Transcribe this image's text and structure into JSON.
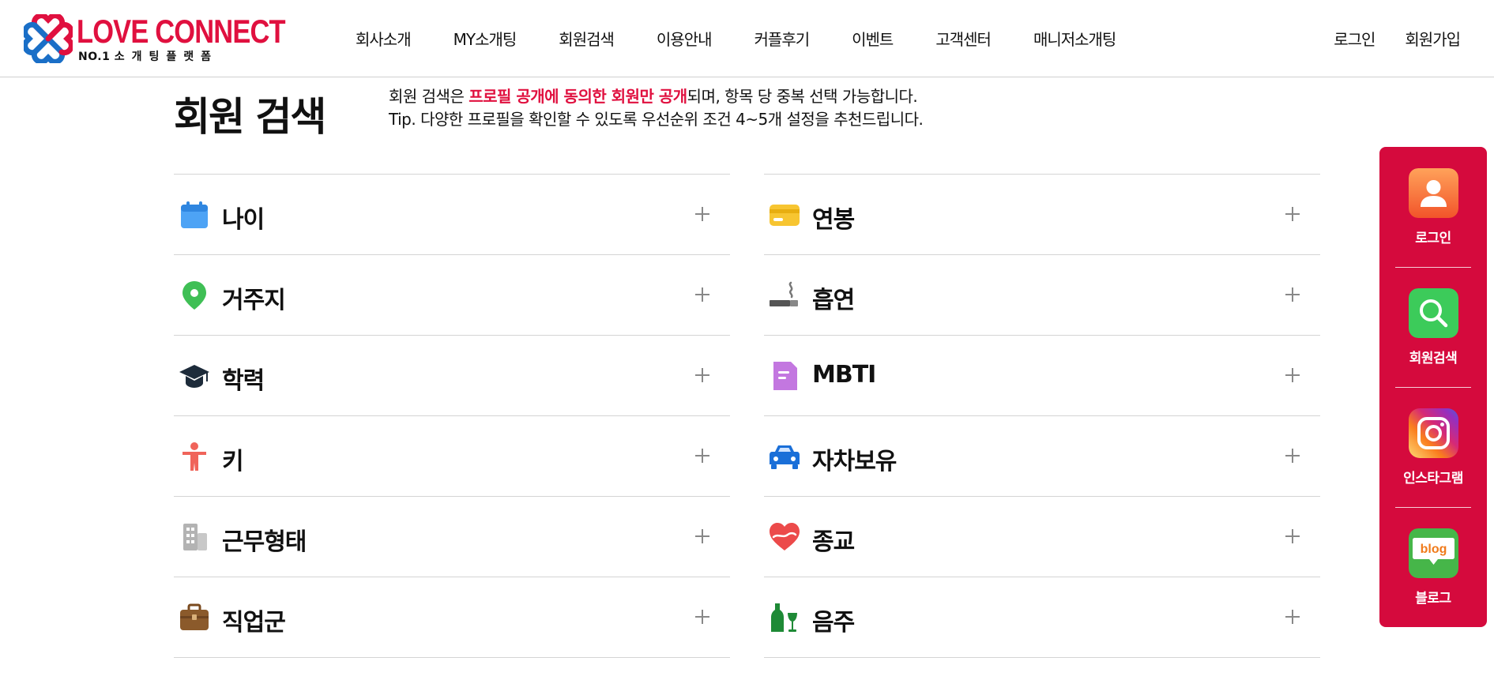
{
  "logo": {
    "name": "LOVE CONNECT",
    "tagline_prefix": "NO.1",
    "tagline": "소개팅플랫폼"
  },
  "nav": [
    "회사소개",
    "MY소개팅",
    "회원검색",
    "이용안내",
    "커플후기",
    "이벤트",
    "고객센터",
    "매니저소개팅"
  ],
  "auth": {
    "login": "로그인",
    "signup": "회원가입"
  },
  "page_title": "회원 검색",
  "description": {
    "line1_before": "회원 검색은 ",
    "line1_highlight": "프로필 공개에 동의한 회원만 공개",
    "line1_after": "되며, 항목 당 중복 선택 가능합니다.",
    "line2": "Tip. 다양한 프로필을 확인할 수 있도록 우선순위 조건 4~5개 설정을 추천드립니다."
  },
  "filters": {
    "left": [
      {
        "label": "나이",
        "icon": "calendar-icon"
      },
      {
        "label": "거주지",
        "icon": "location-pin-icon"
      },
      {
        "label": "학력",
        "icon": "graduation-cap-icon"
      },
      {
        "label": "키",
        "icon": "person-icon"
      },
      {
        "label": "근무형태",
        "icon": "building-icon"
      },
      {
        "label": "직업군",
        "icon": "briefcase-icon"
      }
    ],
    "right": [
      {
        "label": "연봉",
        "icon": "card-icon"
      },
      {
        "label": "흡연",
        "icon": "cigarette-icon"
      },
      {
        "label": "MBTI",
        "icon": "document-icon"
      },
      {
        "label": "자차보유",
        "icon": "car-icon"
      },
      {
        "label": "종교",
        "icon": "heart-icon"
      },
      {
        "label": "음주",
        "icon": "bottle-glass-icon"
      }
    ]
  },
  "quick_menu": [
    {
      "label": "로그인",
      "icon": "user-icon"
    },
    {
      "label": "회원검색",
      "icon": "search-icon"
    },
    {
      "label": "인스타그램",
      "icon": "instagram-icon"
    },
    {
      "label": "블로그",
      "icon": "blog-icon",
      "badge": "blog"
    }
  ],
  "colors": {
    "brand": "#e0103f",
    "quick_bg": "#d50a3d",
    "divider": "#d4d4d4"
  }
}
